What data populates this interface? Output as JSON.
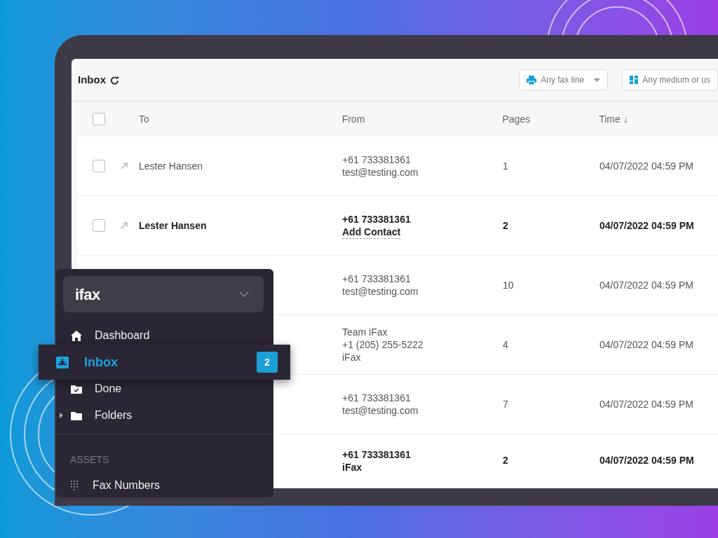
{
  "header": {
    "title": "Inbox",
    "filters": [
      {
        "label": "Any fax line",
        "kind": "printer",
        "dropdown": true
      },
      {
        "label": "Any medium or us",
        "kind": "grid",
        "dropdown": false
      }
    ]
  },
  "table": {
    "select_all_checked": false,
    "columns": [
      "To",
      "From",
      "Pages",
      "Time ↓"
    ],
    "rows": [
      {
        "to": "Lester Hansen",
        "unread": false,
        "from": [
          {
            "text": "+61 733381361",
            "kind": "text"
          },
          {
            "text": "test@testing.com",
            "kind": "text"
          }
        ],
        "pages": "1",
        "time": "04/07/2022 04:59 PM"
      },
      {
        "to": "Lester Hansen",
        "unread": true,
        "from": [
          {
            "text": "+61 733381361",
            "kind": "text"
          },
          {
            "text": "Add Contact",
            "kind": "link"
          }
        ],
        "pages": "2",
        "time": "04/07/2022 04:59 PM"
      },
      {
        "unread": false,
        "from": [
          {
            "text": "+61 733381361",
            "kind": "text"
          },
          {
            "text": "test@testing.com",
            "kind": "text"
          }
        ],
        "pages": "10",
        "time": "04/07/2022 04:59 PM"
      },
      {
        "unread": false,
        "from": [
          {
            "text": "Team iFax",
            "kind": "text"
          },
          {
            "text": "+1 (205) 255-5222",
            "kind": "text"
          },
          {
            "text": "iFax",
            "kind": "text"
          }
        ],
        "pages": "4",
        "time": "04/07/2022 04:59 PM"
      },
      {
        "unread": false,
        "from": [
          {
            "text": "+61 733381361",
            "kind": "text"
          },
          {
            "text": "test@testing.com",
            "kind": "text"
          }
        ],
        "pages": "7",
        "time": "04/07/2022 04:59 PM"
      },
      {
        "unread": true,
        "from": [
          {
            "text": "+61 733381361",
            "kind": "text"
          },
          {
            "text": "iFax",
            "kind": "text"
          }
        ],
        "pages": "2",
        "time": "04/07/2022 04:59 PM"
      }
    ]
  },
  "sidebar": {
    "logo": "ifax",
    "items": [
      {
        "label": "Dashboard",
        "kind": "home",
        "selected": false
      },
      {
        "label": "Inbox",
        "kind": "inbox",
        "selected": true,
        "badge": "2"
      },
      {
        "label": "Done",
        "kind": "done",
        "selected": false
      },
      {
        "label": "Folders",
        "kind": "folder",
        "selected": false,
        "expandable": true
      }
    ],
    "section": "ASSETS",
    "assets": [
      {
        "label": "Fax Numbers",
        "kind": "dialpad"
      }
    ]
  }
}
